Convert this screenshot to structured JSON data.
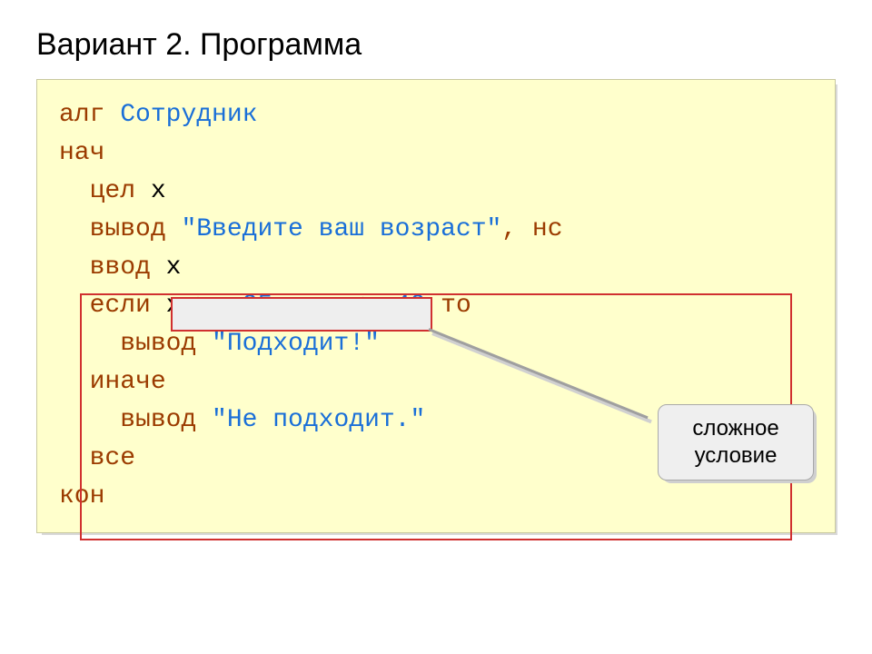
{
  "title": "Вариант 2. Программа",
  "code": {
    "l1_alg": "алг",
    "l1_name": "Сотрудник",
    "l2_nach": "нач",
    "l3_tsel": "цел",
    "l3_x": "x",
    "l4_vyvod": "вывод",
    "l4_str": "\"Введите ваш возраст\"",
    "l4_ns": ", нс",
    "l5_vvod": "ввод",
    "l5_x": "x",
    "l6_esli": "если",
    "l6_cond_a": "x >=",
    "l6_num1": "25",
    "l6_and": "и",
    "l6_cond_b": "x <=",
    "l6_num2": "40",
    "l6_to": "то",
    "l7_vyvod": "вывод",
    "l7_str": "\"Подходит!\"",
    "l8_inache": "иначе",
    "l9_vyvod": "вывод",
    "l9_str": "\"Не подходит.\"",
    "l10_vse": "все",
    "l11_kon": "кон"
  },
  "callout": {
    "line1": "сложное",
    "line2": "условие"
  }
}
